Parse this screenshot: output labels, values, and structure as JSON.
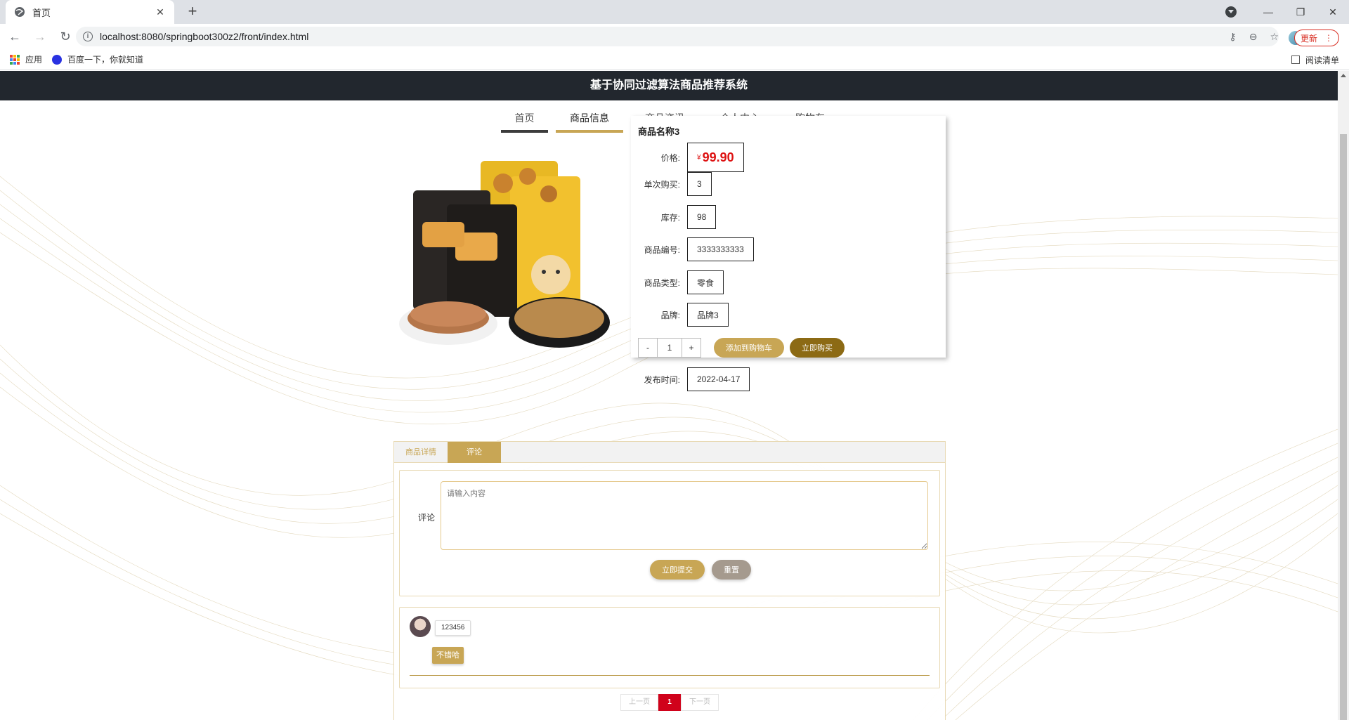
{
  "browser": {
    "tab_title": "首页",
    "url": "localhost:8080/springboot300z2/front/index.html",
    "update_label": "更新",
    "bookmarks": [
      "应用",
      "百度一下，你就知道"
    ],
    "reading_list": "阅读清单"
  },
  "site": {
    "title": "基于协同过滤算法商品推荐系统",
    "nav": [
      "首页",
      "商品信息",
      "商品资讯",
      "个人中心",
      "购物车"
    ],
    "active_nav": "商品信息"
  },
  "product": {
    "name": "商品名称3",
    "currency": "¥",
    "price": "99.90",
    "fields": [
      {
        "label": "价格:",
        "value": "99.90"
      },
      {
        "label": "单次购买:",
        "value": "3"
      },
      {
        "label": "库存:",
        "value": "98"
      },
      {
        "label": "商品编号:",
        "value": "3333333333"
      },
      {
        "label": "商品类型:",
        "value": "零食"
      },
      {
        "label": "品牌:",
        "value": "品牌3"
      },
      {
        "label": "发布时间:",
        "value": "2022-04-17"
      }
    ],
    "quantity": {
      "minus": "-",
      "value": "1",
      "plus": "+"
    },
    "add_to_cart": "添加到购物车",
    "buy_now": "立即购买"
  },
  "detail": {
    "tabs": [
      "商品详情",
      "评论"
    ],
    "active_tab": "评论",
    "comment_label": "评论",
    "comment_placeholder": "请输入内容",
    "submit": "立即提交",
    "reset": "重置",
    "comments": [
      {
        "user": "123456",
        "text": "不错哈"
      }
    ],
    "pager": {
      "prev": "上一页",
      "current": "1",
      "next": "下一页"
    }
  },
  "colors": {
    "accent": "#c8a655",
    "dark_gold": "#8c6a14",
    "header": "#22272e",
    "price": "#dd1111",
    "page_active": "#d0021b"
  }
}
